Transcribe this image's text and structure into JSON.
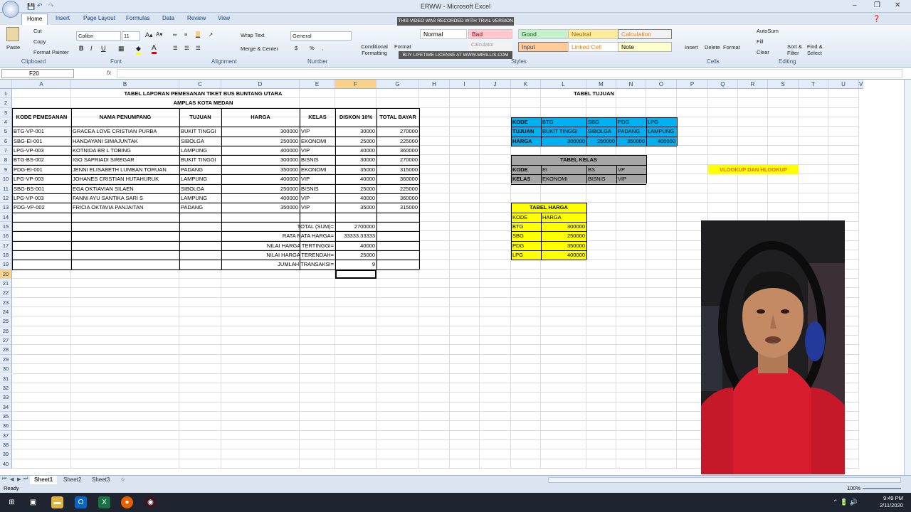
{
  "window": {
    "title": "ERWW - Microsoft Excel"
  },
  "ribbon_tabs": [
    "Home",
    "Insert",
    "Page Layout",
    "Formulas",
    "Data",
    "Review",
    "View"
  ],
  "ribbon": {
    "paste": "Paste",
    "cut": "Cut",
    "copy": "Copy",
    "format_painter": "Format Painter",
    "font_name": "Calibri",
    "font_size": "11",
    "wrap_text": "Wrap Text",
    "merge_center": "Merge & Center",
    "number_format": "General",
    "conditional_formatting": "Conditional Formatting",
    "format_as_table": "Format",
    "styles": {
      "normal": "Normal",
      "bad": "Bad",
      "good": "Good",
      "neutral": "Neutral",
      "calculation": "Calculation",
      "input": "Input",
      "linked_cell": "Linked Cell",
      "note": "Note",
      "calc_short": "Calculator"
    },
    "insert": "Insert",
    "delete": "Delete",
    "format": "Format",
    "autosum": "AutoSum",
    "fill": "Fill",
    "clear": "Clear",
    "sort_filter": "Sort & Filter",
    "find_select": "Find & Select",
    "groups": {
      "clipboard": "Clipboard",
      "font": "Font",
      "alignment": "Alignment",
      "number": "Number",
      "styles": "Styles",
      "cells": "Cells",
      "editing": "Editing"
    }
  },
  "watermark": {
    "top": "THIS VIDEO WAS RECORDED WITH TRIAL VERSION",
    "bottom": "BUY LIFETIME LICENSE AT WWW.MIRILLIS.COM"
  },
  "formula_bar": {
    "name_box": "F20",
    "fx": "fx"
  },
  "columns": [
    "A",
    "B",
    "C",
    "D",
    "E",
    "F",
    "G",
    "H",
    "I",
    "J",
    "K",
    "L",
    "M",
    "N",
    "O",
    "P",
    "Q",
    "R",
    "S",
    "T",
    "U",
    "V"
  ],
  "rows": [
    "1",
    "2",
    "3",
    "4",
    "5",
    "6",
    "7",
    "8",
    "9",
    "10",
    "11",
    "12",
    "13",
    "14",
    "15",
    "16",
    "17",
    "18",
    "19",
    "20",
    "21",
    "22",
    "23",
    "24",
    "25",
    "26",
    "27",
    "28",
    "29",
    "30",
    "31",
    "32",
    "33",
    "34",
    "35",
    "36",
    "37",
    "38",
    "39",
    "40"
  ],
  "main_table": {
    "title1": "TABEL LAPORAN PEMESANAN TIKET BUS BUNTANG UTARA",
    "title2": "AMPLAS KOTA MEDAN",
    "headers": [
      "KODE PEMESANAN",
      "NAMA PENUMPANG",
      "TUJUAN",
      "HARGA",
      "KELAS",
      "DISKON  10%",
      "TOTAL BAYAR"
    ],
    "rows": [
      [
        "BTG-VP-001",
        "GRACEA  LOVE CRISTIAN PURBA",
        "BUKIT TINGGI",
        "300000",
        "VIP",
        "30000",
        "270000"
      ],
      [
        "SBG-EI-001",
        "HANDAYANI SIMAJUNTAK",
        "SIBOLGA",
        "250000",
        "EKONOMI",
        "25000",
        "225000"
      ],
      [
        "LPG-VP-003",
        "KOTNIDA BR L TOBING",
        "LAMPUNG",
        "400000",
        "VIP",
        "40000",
        "360000"
      ],
      [
        "BTG-BS-002",
        "IGO SAPRIADI SIREGAR",
        "BUKIT TINGGI",
        "300000",
        "BISNIS",
        "30000",
        "270000"
      ],
      [
        "PDG-EI-001",
        "JENNI ELISABETH LUMBAN TORUAN",
        "PADANG",
        "350000",
        "EKONOMI",
        "35000",
        "315000"
      ],
      [
        "LPG-VP-003",
        "JOHANES CRISTIAN HUTAHURUK",
        "LAMPUNG",
        "400000",
        "VIP",
        "40000",
        "360000"
      ],
      [
        "SBG-BS-001",
        "EGA OKTIAVIAN SILAEN",
        "SIBOLGA",
        "250000",
        "BISNIS",
        "25000",
        "225000"
      ],
      [
        "LPG-VP-003",
        "FANNI AYU SANTIKA SARI S",
        "LAMPUNG",
        "400000",
        "VIP",
        "40000",
        "360000"
      ],
      [
        "PDG-VP-002",
        "FRICIA OKTAVIA PANJAITAN",
        "PADANG",
        "350000",
        "VIP",
        "35000",
        "315000"
      ]
    ],
    "summary": [
      [
        "TOTAL (SUM)=",
        "2700000"
      ],
      [
        "RATA RATA HARGA=",
        "33333.33333"
      ],
      [
        "NILAI HARGA TERTINGGI=",
        "40000"
      ],
      [
        "NILAI HARGA TERENDAH=",
        "25000"
      ],
      [
        "JUMLAH TRANSAKSI=",
        "9"
      ]
    ]
  },
  "tabel_tujuan": {
    "title": "TABEL TUJUAN",
    "rows": [
      [
        "KODE",
        "BTG",
        "SBG",
        "PDG",
        "LPG"
      ],
      [
        "TUJUAN",
        "BUKIT TINGGI",
        "SIBOLGA",
        "PADANG",
        "LAMPUNG"
      ],
      [
        "HARGA",
        "300000",
        "250000",
        "350000",
        "400000"
      ]
    ],
    "color": "#00b0f0"
  },
  "tabel_kelas": {
    "title": "TABEL KELAS",
    "rows": [
      [
        "KODE",
        "EI",
        "BS",
        "VP"
      ],
      [
        "KELAS",
        "EKONOMI",
        "BISNIS",
        "VIP"
      ]
    ],
    "color": "#a6a6a6"
  },
  "tabel_harga": {
    "title": "TABEL HARGA",
    "headers": [
      "KODE",
      "HARGA"
    ],
    "rows": [
      [
        "BTG",
        "300000"
      ],
      [
        "SBG",
        "250000"
      ],
      [
        "PDG",
        "350000"
      ],
      [
        "LPG",
        "400000"
      ]
    ],
    "color": "#ffff00"
  },
  "vlookup_label": "VLOOKUP  DAN HLOOKUP",
  "sheet_tabs": [
    "Sheet1",
    "Sheet2",
    "Sheet3"
  ],
  "status": {
    "ready": "Ready",
    "zoom": "100%"
  },
  "taskbar": {
    "time": "9:49 PM",
    "date": "2/11/2020"
  }
}
